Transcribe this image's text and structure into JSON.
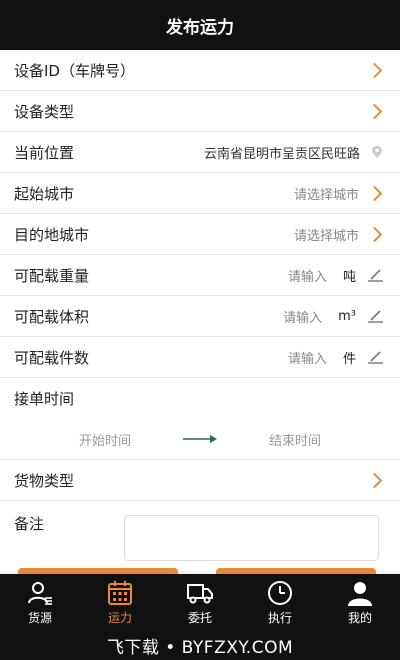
{
  "header": {
    "title": "发布运力"
  },
  "form": {
    "device_id": {
      "label": "设备ID（车牌号）"
    },
    "device_type": {
      "label": "设备类型"
    },
    "current_location": {
      "label": "当前位置",
      "value": "云南省昆明市呈贡区民旺路"
    },
    "start_city": {
      "label": "起始城市",
      "placeholder": "请选择城市"
    },
    "destination_city": {
      "label": "目的地城市",
      "placeholder": "请选择城市"
    },
    "weight": {
      "label": "可配载重量",
      "placeholder": "请输入",
      "unit": "吨"
    },
    "volume": {
      "label": "可配载体积",
      "placeholder": "请输入",
      "unit": "m³"
    },
    "pieces": {
      "label": "可配载件数",
      "placeholder": "请输入",
      "unit": "件"
    },
    "order_time": {
      "label": "接单时间",
      "start_placeholder": "开始时间",
      "end_placeholder": "结束时间"
    },
    "cargo_type": {
      "label": "货物类型"
    },
    "remark": {
      "label": "备注"
    }
  },
  "tabbar": {
    "items": [
      {
        "label": "货源",
        "icon": "user-icon",
        "active": false
      },
      {
        "label": "运力",
        "icon": "calendar-icon",
        "active": true
      },
      {
        "label": "委托",
        "icon": "truck-icon",
        "active": false
      },
      {
        "label": "执行",
        "icon": "clock-icon",
        "active": false
      },
      {
        "label": "我的",
        "icon": "person-icon",
        "active": false
      }
    ]
  },
  "watermark": {
    "text": "飞下载 • BYFZXY.COM"
  },
  "colors": {
    "accent": "#e58b3a",
    "header_bg": "#111111",
    "arrow": "#2a6b60"
  }
}
